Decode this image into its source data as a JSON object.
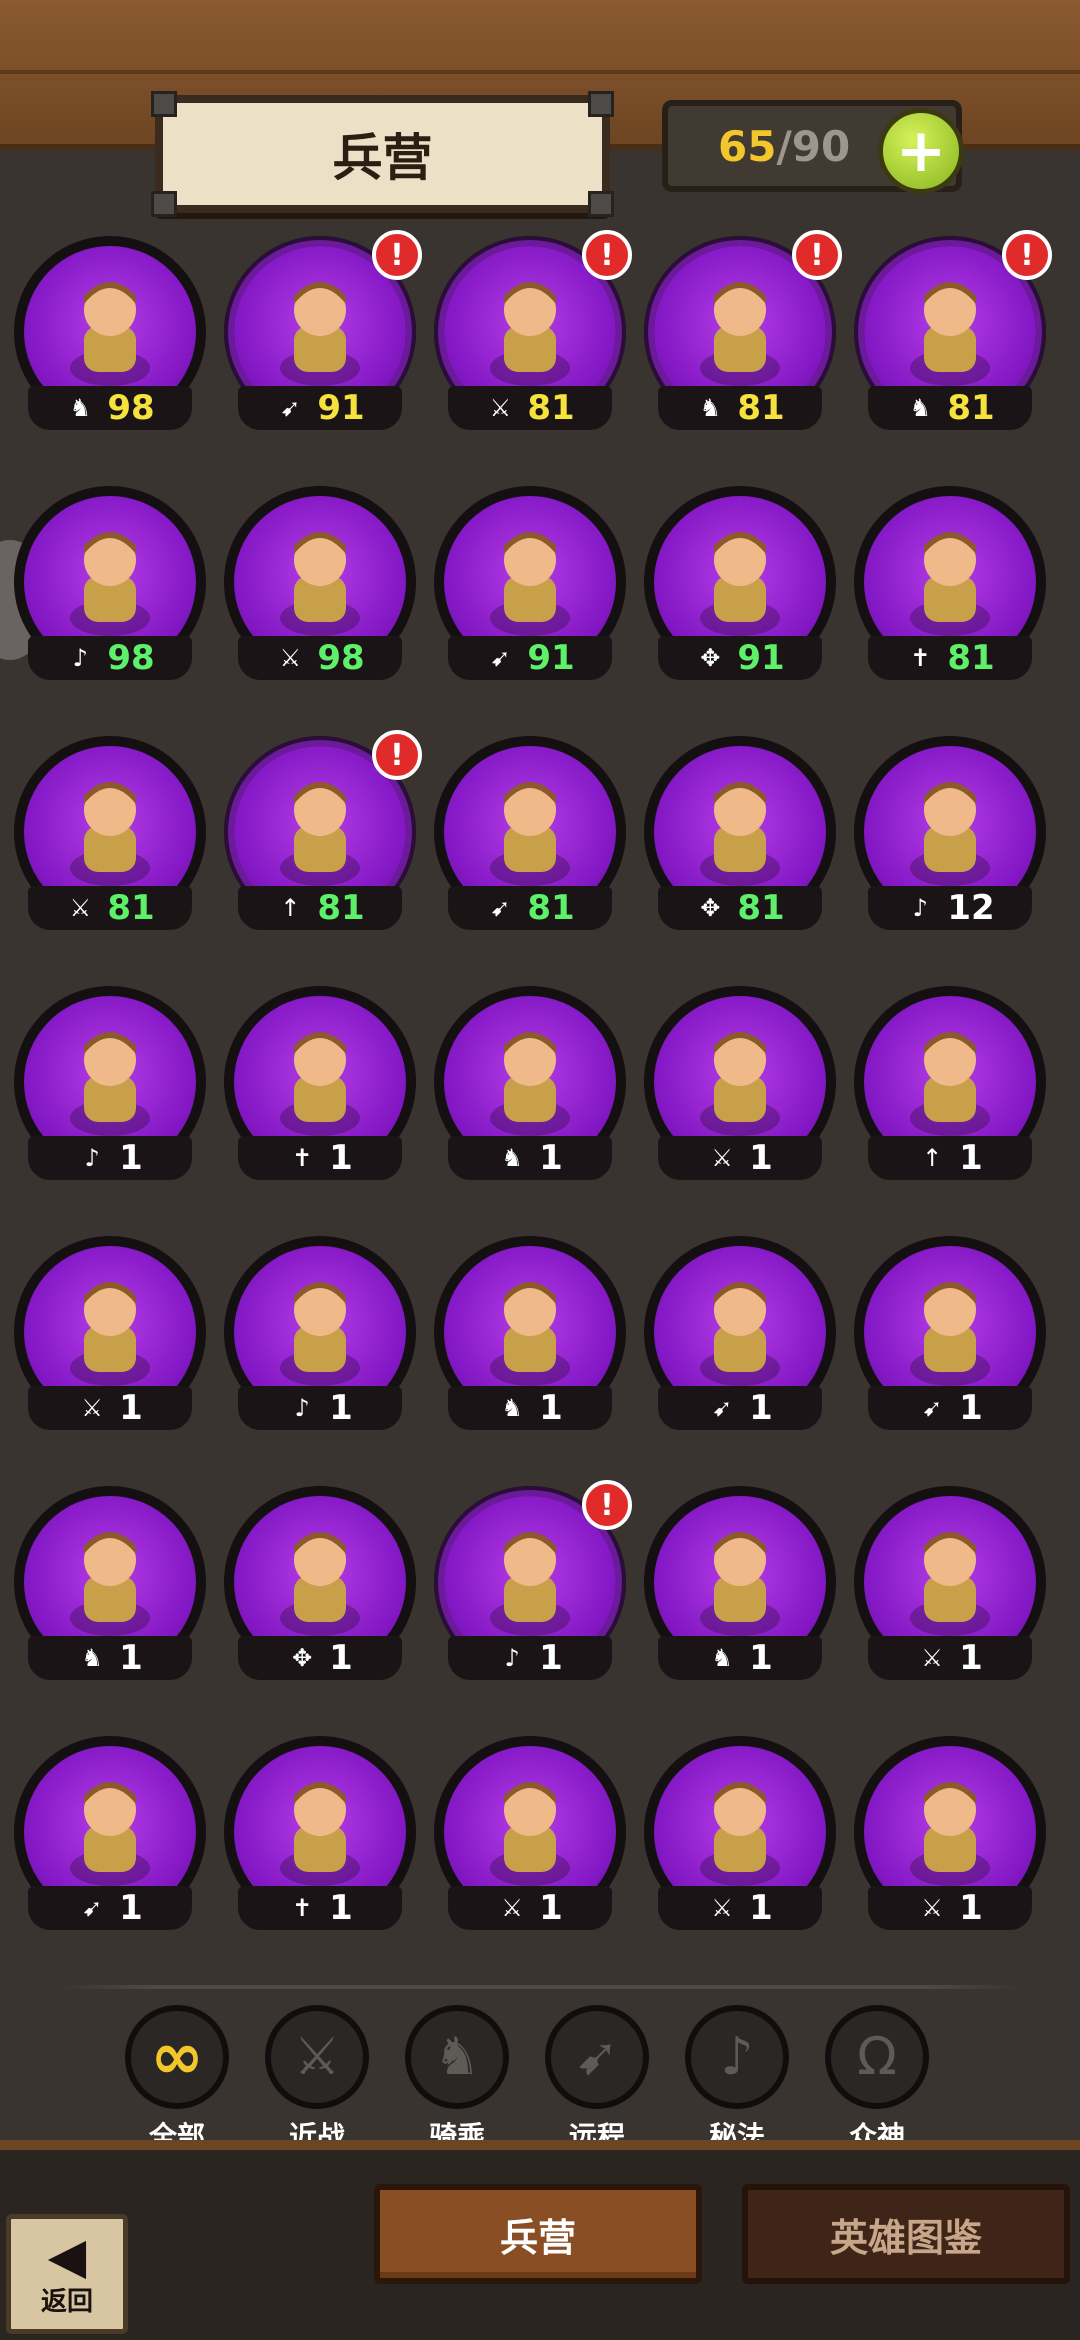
{
  "header": {
    "title": "兵营",
    "capacity_current": "65",
    "capacity_sep": "/",
    "capacity_max": "90",
    "add_button": "+"
  },
  "heroes": [
    {
      "cls": "mount",
      "level": "98",
      "color": "gold",
      "alert": false
    },
    {
      "cls": "ranged",
      "level": "91",
      "color": "gold",
      "alert": true
    },
    {
      "cls": "melee",
      "level": "81",
      "color": "gold",
      "alert": true
    },
    {
      "cls": "mount",
      "level": "81",
      "color": "gold",
      "alert": true
    },
    {
      "cls": "mount",
      "level": "81",
      "color": "gold",
      "alert": true
    },
    {
      "cls": "magic",
      "level": "98",
      "color": "green",
      "alert": false
    },
    {
      "cls": "melee",
      "level": "98",
      "color": "green",
      "alert": false
    },
    {
      "cls": "ranged",
      "level": "91",
      "color": "green",
      "alert": false
    },
    {
      "cls": "beast",
      "level": "91",
      "color": "green",
      "alert": false
    },
    {
      "cls": "holy",
      "level": "81",
      "color": "green",
      "alert": false
    },
    {
      "cls": "melee",
      "level": "81",
      "color": "green",
      "alert": false
    },
    {
      "cls": "spear",
      "level": "81",
      "color": "green",
      "alert": true
    },
    {
      "cls": "ranged",
      "level": "81",
      "color": "green",
      "alert": false
    },
    {
      "cls": "beast",
      "level": "81",
      "color": "green",
      "alert": false
    },
    {
      "cls": "magic",
      "level": "12",
      "color": "white",
      "alert": false
    },
    {
      "cls": "magic",
      "level": "1",
      "color": "white",
      "alert": false
    },
    {
      "cls": "holy",
      "level": "1",
      "color": "white",
      "alert": false
    },
    {
      "cls": "mount",
      "level": "1",
      "color": "white",
      "alert": false
    },
    {
      "cls": "melee",
      "level": "1",
      "color": "white",
      "alert": false
    },
    {
      "cls": "spear",
      "level": "1",
      "color": "white",
      "alert": false
    },
    {
      "cls": "melee",
      "level": "1",
      "color": "white",
      "alert": false
    },
    {
      "cls": "magic",
      "level": "1",
      "color": "white",
      "alert": false
    },
    {
      "cls": "mount",
      "level": "1",
      "color": "white",
      "alert": false
    },
    {
      "cls": "ranged",
      "level": "1",
      "color": "white",
      "alert": false
    },
    {
      "cls": "ranged",
      "level": "1",
      "color": "white",
      "alert": false
    },
    {
      "cls": "mount",
      "level": "1",
      "color": "white",
      "alert": false
    },
    {
      "cls": "beast",
      "level": "1",
      "color": "white",
      "alert": false
    },
    {
      "cls": "magic",
      "level": "1",
      "color": "white",
      "alert": true
    },
    {
      "cls": "mount",
      "level": "1",
      "color": "white",
      "alert": false
    },
    {
      "cls": "melee",
      "level": "1",
      "color": "white",
      "alert": false
    },
    {
      "cls": "ranged",
      "level": "1",
      "color": "white",
      "alert": false
    },
    {
      "cls": "holy",
      "level": "1",
      "color": "white",
      "alert": false
    },
    {
      "cls": "melee",
      "level": "1",
      "color": "white",
      "alert": false
    },
    {
      "cls": "melee",
      "level": "1",
      "color": "white",
      "alert": false
    },
    {
      "cls": "melee",
      "level": "1",
      "color": "white",
      "alert": false
    }
  ],
  "class_glyphs": {
    "mount": "♞",
    "ranged": "➹",
    "melee": "⚔",
    "magic": "♪",
    "beast": "✥",
    "holy": "✝",
    "spear": "↑"
  },
  "filters": [
    {
      "icon": "∞",
      "label": "全部",
      "active": true
    },
    {
      "icon": "⚔",
      "label": "近战",
      "active": false
    },
    {
      "icon": "♞",
      "label": "骑乘",
      "active": false
    },
    {
      "icon": "➹",
      "label": "远程",
      "active": false
    },
    {
      "icon": "♪",
      "label": "秘法",
      "active": false
    },
    {
      "icon": "Ω",
      "label": "众神",
      "active": false
    }
  ],
  "bottom": {
    "back_arrow": "◀",
    "back_label": "返回",
    "tab_barracks": "兵营",
    "tab_codex": "英雄图鉴"
  },
  "alert_glyph": "!",
  "colors": {
    "disc_purple": "#8318c4",
    "level_gold": "#f6e23c",
    "level_green": "#5ff06a",
    "alert_red": "#e12a2a",
    "accent_yellow": "#f3c62c"
  }
}
